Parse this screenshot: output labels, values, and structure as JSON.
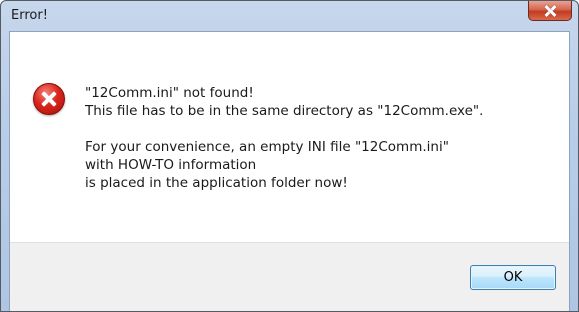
{
  "window": {
    "title": "Error!"
  },
  "dialog": {
    "icon": "error-icon",
    "message_lines": [
      "\"12Comm.ini\" not found!",
      "This file has to be in the same directory as \"12Comm.exe\".",
      "",
      "For your convenience, an empty INI file \"12Comm.ini\"",
      "with HOW-TO information",
      "is placed in the application folder now!"
    ],
    "ok_label": "OK"
  },
  "colors": {
    "accent_border": "#3c7fb1",
    "close_button": "#c33a21",
    "error_icon": "#d9261c",
    "footer_bg": "#f0f0f0"
  }
}
